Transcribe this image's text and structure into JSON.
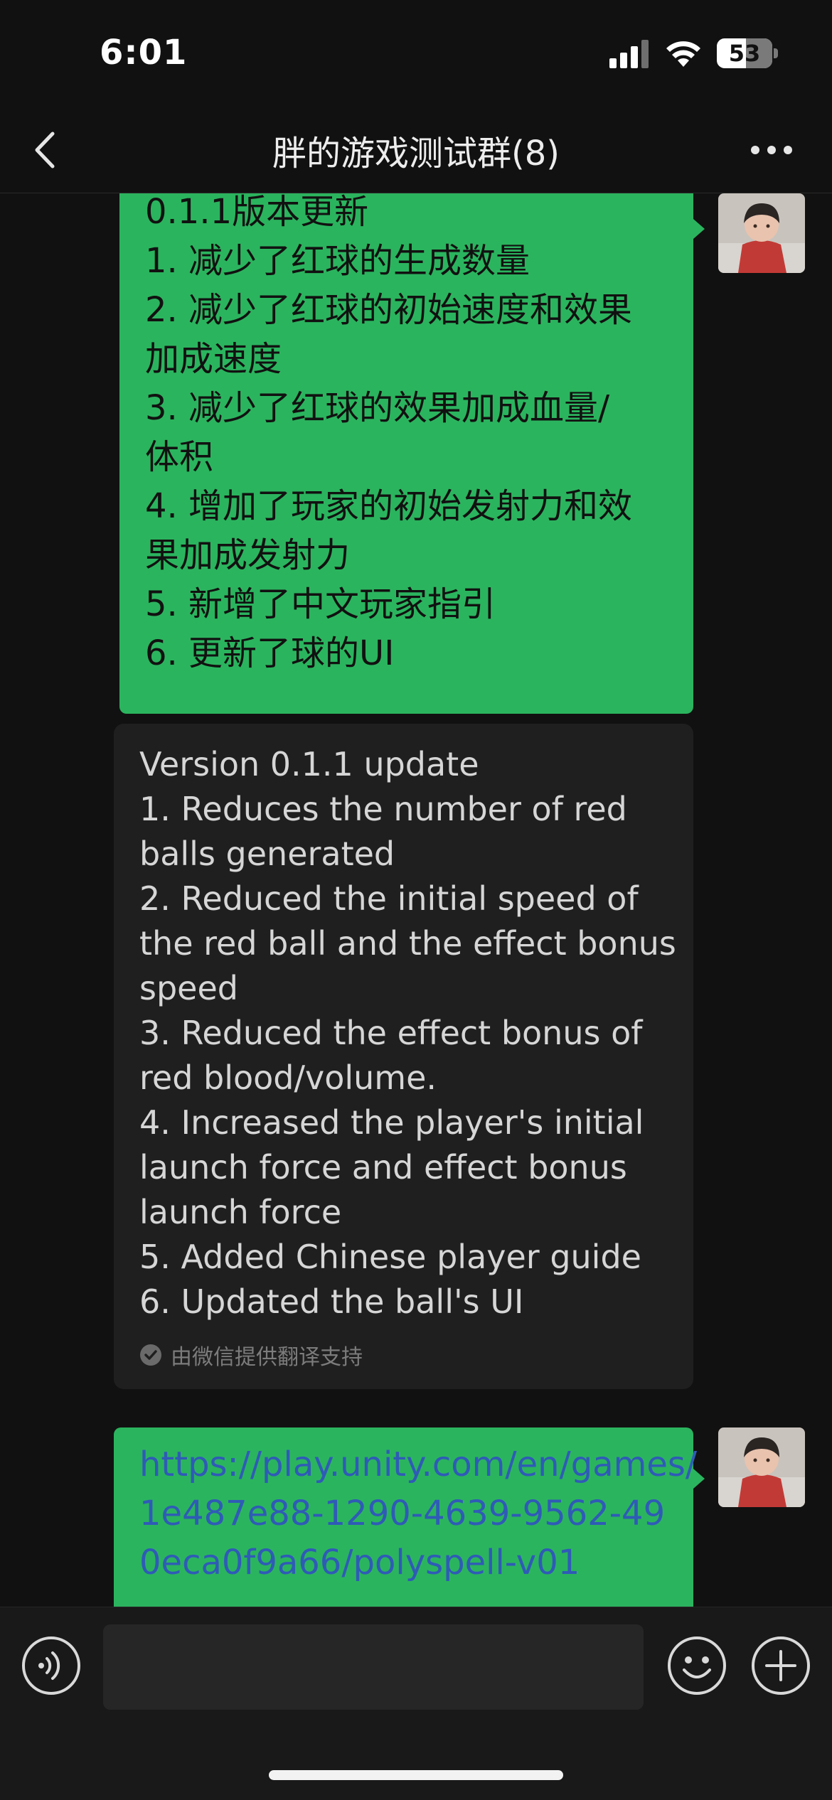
{
  "status_bar": {
    "time": "6:01",
    "battery": "53",
    "battery_level": 0.53,
    "icons": [
      "signal-icon",
      "wifi-icon",
      "battery-icon"
    ]
  },
  "nav": {
    "title": "胖的游戏测试群(8)",
    "back_icon": "chevron-left-icon",
    "more_icon": "more-dots-icon"
  },
  "messages": {
    "update_cn": {
      "lines": [
        "0.1.1版本更新",
        "1. 减少了红球的生成数量",
        "2. 减少了红球的初始速度和效果",
        "加成速度",
        "3. 减少了红球的效果加成血量/",
        "体积",
        "4. 增加了玩家的初始发射力和效",
        "果加成发射力",
        "5. 新增了中文玩家指引",
        "6. 更新了球的UI"
      ]
    },
    "translation": {
      "lines": [
        "Version 0.1.1 update",
        "1. Reduces the number of red",
        "balls generated",
        "2. Reduced the initial speed of",
        "the red ball and the effect bonus",
        "speed",
        "3. Reduced the effect bonus of",
        "red blood/volume.",
        "4. Increased the player's initial",
        "launch force and effect bonus",
        "launch force",
        "5. Added Chinese player guide",
        "6. Updated the ball's UI"
      ],
      "credit": "由微信提供翻译支持"
    },
    "link_message": {
      "lines": [
        "https://play.unity.com/en/games/",
        "1e487e88-1290-4639-9562-49",
        "0eca0f9a66/polyspell-v01"
      ]
    }
  },
  "input_bar": {
    "placeholder": "",
    "voice_icon": "voice-icon",
    "emoji_icon": "emoji-icon",
    "plus_icon": "plus-icon"
  },
  "colors": {
    "background": "#111111",
    "bubble_green": "#2bb45e",
    "link": "#2f5bb7",
    "translation_bg": "#1f1f1f"
  }
}
